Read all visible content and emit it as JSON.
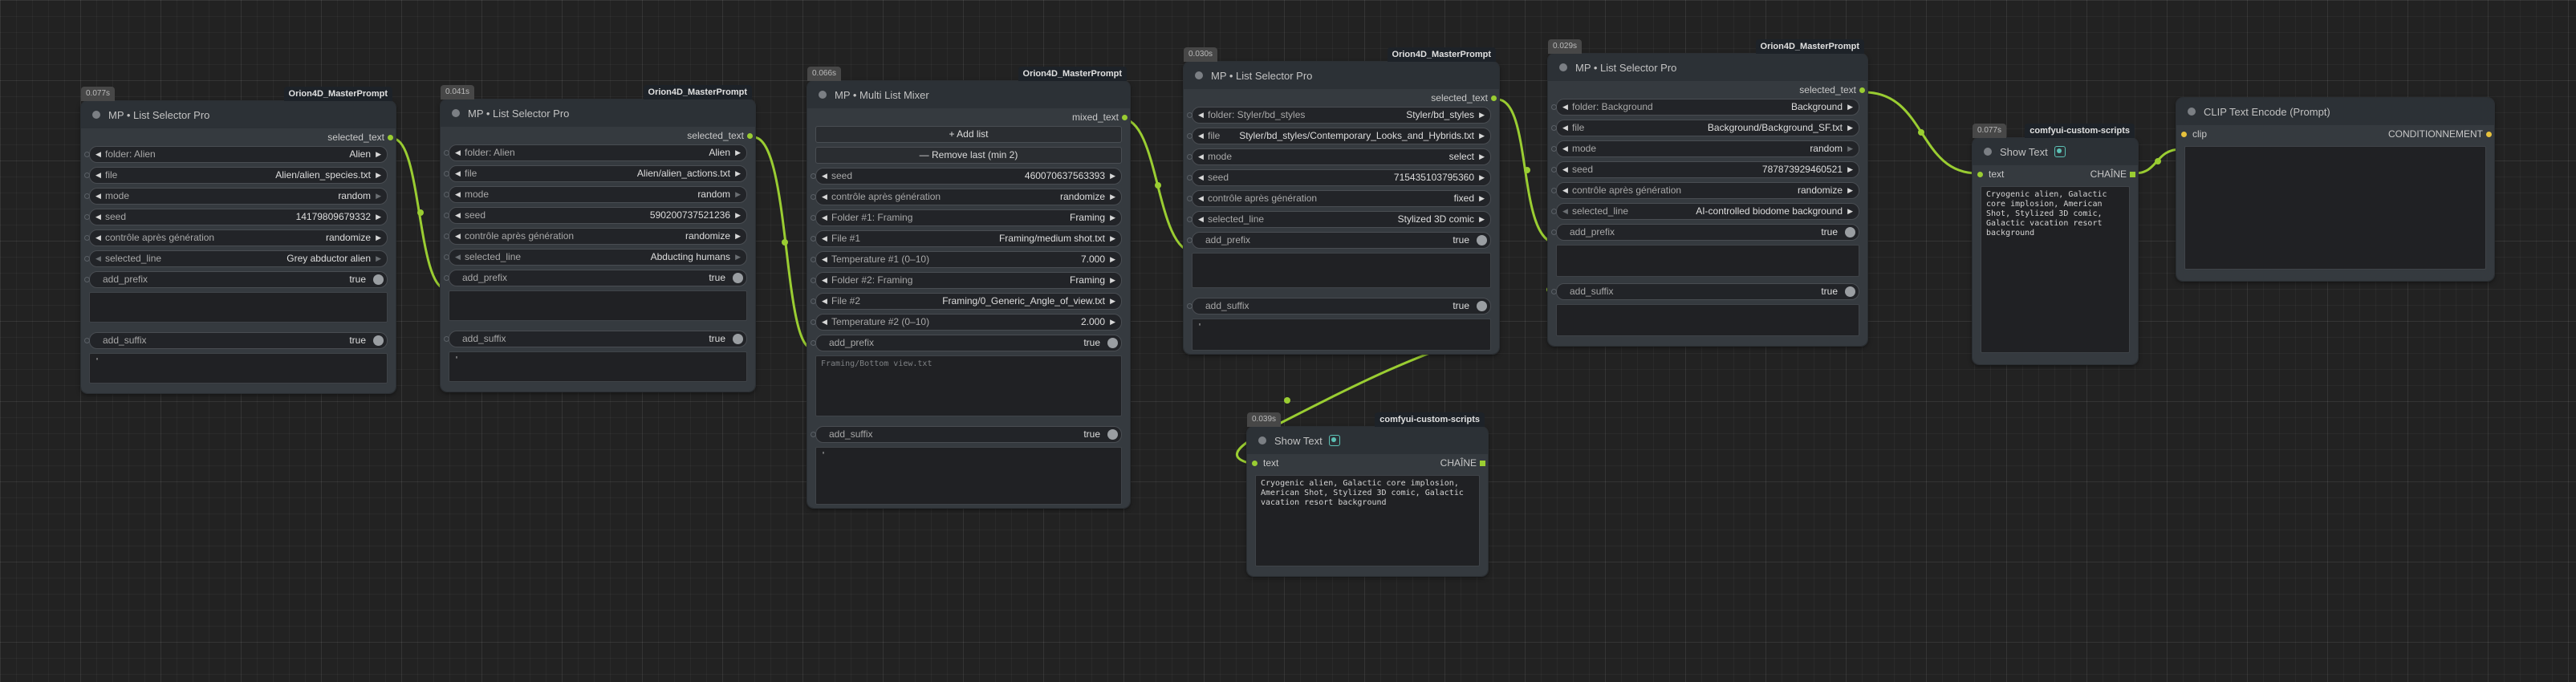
{
  "colors": {
    "canvas": "#222222",
    "node": "#353a3f",
    "header": "#2c3136",
    "link": "#9acd32",
    "clip_slot": "#e7c13c"
  },
  "nodes": {
    "n1": {
      "timing": "0.077s",
      "badge": "Orion4D_MasterPrompt",
      "title": "MP • List Selector Pro",
      "output": "selected_text",
      "widgets": [
        {
          "label": "folder: Alien",
          "value": "Alien"
        },
        {
          "label": "file",
          "value": "Alien/alien_species.txt"
        },
        {
          "label": "mode",
          "value": "random"
        },
        {
          "label": "seed",
          "value": "14179809679332"
        },
        {
          "label": "contrôle après génération",
          "value": "randomize"
        },
        {
          "label": "selected_line",
          "value": "Grey abductor alien"
        }
      ],
      "prefix": {
        "label": "add_prefix",
        "value": "true"
      },
      "suffix": {
        "label": "add_suffix",
        "value": "true"
      },
      "suffix_text": "'"
    },
    "n2": {
      "timing": "0.041s",
      "badge": "Orion4D_MasterPrompt",
      "title": "MP • List Selector Pro",
      "output": "selected_text",
      "widgets": [
        {
          "label": "folder: Alien",
          "value": "Alien"
        },
        {
          "label": "file",
          "value": "Alien/alien_actions.txt"
        },
        {
          "label": "mode",
          "value": "random"
        },
        {
          "label": "seed",
          "value": "590200737521236"
        },
        {
          "label": "contrôle après génération",
          "value": "randomize"
        },
        {
          "label": "selected_line",
          "value": "Abducting humans"
        }
      ],
      "prefix": {
        "label": "add_prefix",
        "value": "true"
      },
      "suffix": {
        "label": "add_suffix",
        "value": "true"
      },
      "suffix_text": "'"
    },
    "n3": {
      "timing": "0.066s",
      "badge": "Orion4D_MasterPrompt",
      "title": "MP • Multi List Mixer",
      "output": "mixed_text",
      "add_button": "+ Add list",
      "remove_button": "— Remove last (min 2)",
      "widgets": [
        {
          "label": "seed",
          "value": "460070637563393"
        },
        {
          "label": "contrôle après génération",
          "value": "randomize"
        },
        {
          "label": "Folder #1: Framing",
          "value": "Framing"
        },
        {
          "label": "File #1",
          "value": "Framing/medium shot.txt"
        },
        {
          "label": "Temperature #1 (0–10)",
          "value": "7.000"
        },
        {
          "label": "Folder #2: Framing",
          "value": "Framing"
        },
        {
          "label": "File #2",
          "value": "Framing/0_Generic_Angle_of_view.txt"
        },
        {
          "label": "Temperature #2 (0–10)",
          "value": "2.000"
        }
      ],
      "prefix": {
        "label": "add_prefix",
        "value": "true"
      },
      "prefix_text": "Framing/Bottom view.txt",
      "suffix": {
        "label": "add_suffix",
        "value": "true"
      },
      "suffix_text": "'"
    },
    "n4": {
      "timing": "0.030s",
      "badge": "Orion4D_MasterPrompt",
      "title": "MP • List Selector Pro",
      "output": "selected_text",
      "widgets": [
        {
          "label": "folder: Styler/bd_styles",
          "value": "Styler/bd_styles"
        },
        {
          "label": "file",
          "value": "Styler/bd_styles/Contemporary_Looks_and_Hybrids.txt"
        },
        {
          "label": "mode",
          "value": "select"
        },
        {
          "label": "seed",
          "value": "715435103795360"
        },
        {
          "label": "contrôle après génération",
          "value": "fixed"
        },
        {
          "label": "selected_line",
          "value": "Stylized 3D comic"
        }
      ],
      "prefix": {
        "label": "add_prefix",
        "value": "true"
      },
      "suffix": {
        "label": "add_suffix",
        "value": "true"
      },
      "suffix_text": "'"
    },
    "n5": {
      "timing": "0.029s",
      "badge": "Orion4D_MasterPrompt",
      "title": "MP • List Selector Pro",
      "output": "selected_text",
      "widgets": [
        {
          "label": "folder: Background",
          "value": "Background"
        },
        {
          "label": "file",
          "value": "Background/Background_SF.txt"
        },
        {
          "label": "mode",
          "value": "random"
        },
        {
          "label": "seed",
          "value": "787873929460521"
        },
        {
          "label": "contrôle après génération",
          "value": "randomize"
        },
        {
          "label": "selected_line",
          "value": "AI-controlled biodome background"
        }
      ],
      "prefix": {
        "label": "add_prefix",
        "value": "true"
      },
      "suffix": {
        "label": "add_suffix",
        "value": "true"
      }
    },
    "n6": {
      "timing": "0.039s",
      "badge": "comfyui-custom-scripts",
      "title": "Show Text",
      "input": "text",
      "output": "CHAÎNE",
      "text": "Cryogenic alien, Galactic core implosion, American Shot, Stylized 3D comic, Galactic vacation resort background"
    },
    "n7": {
      "timing": "0.077s",
      "badge": "comfyui-custom-scripts",
      "title": "Show Text",
      "input": "text",
      "output": "CHAÎNE",
      "text": "Cryogenic alien, Galactic core implosion, American Shot, Stylized 3D comic, Galactic vacation resort background"
    },
    "n8": {
      "title": "CLIP Text Encode (Prompt)",
      "input": "clip",
      "output": "CONDITIONNEMENT"
    }
  }
}
